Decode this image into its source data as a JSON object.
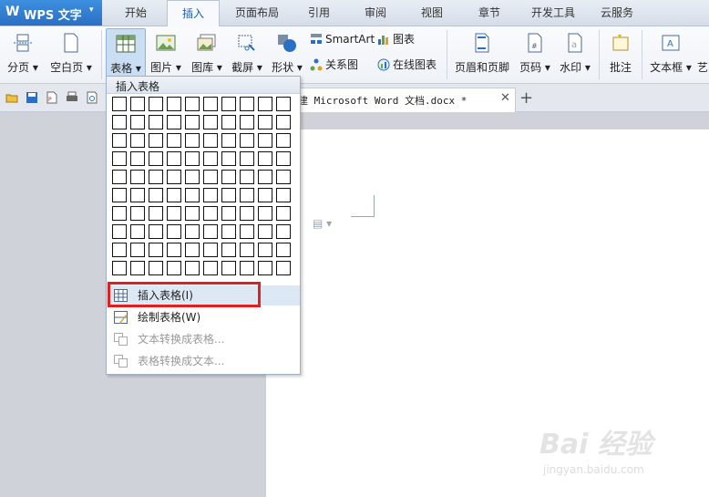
{
  "app": {
    "logo": "W",
    "title": "WPS 文字",
    "menu_arrow": "▾"
  },
  "tabs": [
    {
      "label": "开始"
    },
    {
      "label": "插入"
    },
    {
      "label": "页面布局"
    },
    {
      "label": "引用"
    },
    {
      "label": "审阅"
    },
    {
      "label": "视图"
    },
    {
      "label": "章节"
    },
    {
      "label": "开发工具"
    },
    {
      "label": "云服务"
    }
  ],
  "active_tab": "插入",
  "ribbon": {
    "page_break": "分页 ▾",
    "blank_page": "空白页 ▾",
    "table": "表格 ▾",
    "picture": "图片 ▾",
    "gallery": "图库 ▾",
    "screenshot": "截屏 ▾",
    "shapes": "形状 ▾",
    "smartart": "SmartArt",
    "chart": "图表",
    "relation_chart": "关系图",
    "online_chart": "在线图表",
    "header_footer": "页眉和页脚",
    "page_number": "页码 ▾",
    "watermark": "水印 ▾",
    "comment": "批注",
    "textbox": "文本框 ▾",
    "art": "艺"
  },
  "doc_tab": {
    "title": "建 Microsoft Word 文档.docx *",
    "close": "✕",
    "new": "+"
  },
  "table_menu": {
    "header": "插入表格",
    "grid_rows": 10,
    "grid_cols": 10,
    "items": [
      {
        "label": "插入表格(I)",
        "state": "highlighted"
      },
      {
        "label": "绘制表格(W)",
        "state": "enabled"
      },
      {
        "label": "文本转换成表格...",
        "state": "disabled"
      },
      {
        "label": "表格转换成文本...",
        "state": "disabled"
      }
    ]
  },
  "watermark": {
    "brand": "Bai 经验",
    "url": "jingyan.baidu.com"
  },
  "colors": {
    "accent": "#2a6fc4",
    "highlight_box": "#e02020",
    "menu_hover": "#dde8f5"
  }
}
